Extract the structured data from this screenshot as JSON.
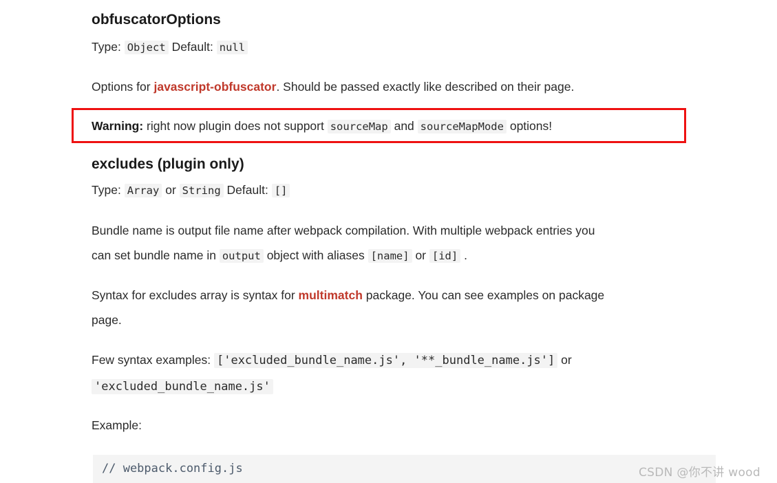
{
  "page": {
    "background": "#ffffff",
    "text_color": "#2b2b2b",
    "link_color": "#c0392b",
    "code_bg": "#f3f3f3",
    "warning_border_color": "#ee1111",
    "codeblock_bg": "#f4f4f4"
  },
  "sections": {
    "obfuscator": {
      "heading": "obfuscatorOptions",
      "type_label": "Type:",
      "type_value": "Object",
      "default_label": "Default:",
      "default_value": "null",
      "description_pre": "Options for ",
      "description_link": "javascript-obfuscator",
      "description_post": ". Should be passed exactly like described on their page."
    },
    "warning": {
      "label": "Warning:",
      "text_1": " right now plugin does not support ",
      "code_1": "sourceMap",
      "text_2": " and ",
      "code_2": "sourceMapMode",
      "text_3": " options!"
    },
    "excludes": {
      "heading": "excludes (plugin only)",
      "type_label": "Type:",
      "type_value_1": "Array",
      "type_or": "or",
      "type_value_2": "String",
      "default_label": "Default:",
      "default_value": "[]",
      "paragraph1_a": "Bundle name is output file name after webpack compilation. With multiple webpack entries you",
      "paragraph1_b_pre": "can set bundle name in ",
      "paragraph1_b_code1": "output",
      "paragraph1_b_mid": " object with aliases ",
      "paragraph1_b_code2": "[name]",
      "paragraph1_b_or": " or ",
      "paragraph1_b_code3": "[id]",
      "paragraph1_b_end": " .",
      "paragraph2_pre": "Syntax for excludes array is syntax for ",
      "paragraph2_link": "multimatch",
      "paragraph2_post": " package. You can see examples on package",
      "paragraph2_line2": "page.",
      "syntax_label": "Few syntax examples: ",
      "syntax_code_line1": "['excluded_bundle_name.js', '**_bundle_name.js']",
      "syntax_or": " or",
      "syntax_code_line2": "'excluded_bundle_name.js'",
      "example_label": "Example:"
    }
  },
  "codeblock": {
    "line1": "// webpack.config.js"
  },
  "watermark": {
    "text": "CSDN @你不讲 wood"
  }
}
